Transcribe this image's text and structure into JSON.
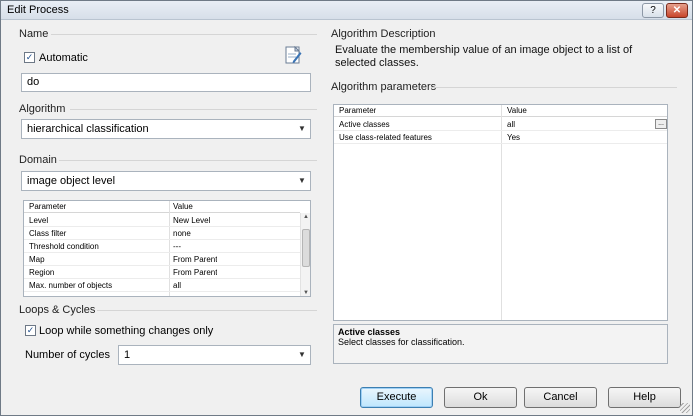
{
  "window": {
    "title": "Edit Process",
    "help_glyph": "?",
    "close_glyph": "✕"
  },
  "name_section": {
    "label": "Name",
    "automatic_label": "Automatic",
    "automatic_checked": true,
    "name_value": "do",
    "edit_icon": "notepad-edit-icon"
  },
  "algorithm_section": {
    "label": "Algorithm",
    "selected": "hierarchical classification"
  },
  "domain_section": {
    "label": "Domain",
    "selected": "image object level",
    "grid_headers": [
      "Parameter",
      "Value"
    ],
    "rows": [
      [
        "Level",
        "New Level"
      ],
      [
        "Class filter",
        "none"
      ],
      [
        "Threshold condition",
        "---"
      ],
      [
        "Map",
        "From Parent"
      ],
      [
        "Region",
        "From Parent"
      ],
      [
        "Max. number of objects",
        "all"
      ]
    ]
  },
  "loops_section": {
    "label": "Loops & Cycles",
    "loop_label": "Loop while something changes only",
    "loop_checked": true,
    "cycles_label": "Number of cycles",
    "cycles_value": "1"
  },
  "description_section": {
    "label": "Algorithm Description",
    "text": "Evaluate the membership value of an image object to a list of selected classes."
  },
  "parameters_section": {
    "label": "Algorithm parameters",
    "grid_headers": [
      "Parameter",
      "Value"
    ],
    "rows": [
      [
        "Active classes",
        "all"
      ],
      [
        "Use class-related features",
        "Yes"
      ]
    ],
    "ellipsis_label": "...",
    "info_title": "Active classes",
    "info_text": "Select classes for classification."
  },
  "buttons": {
    "execute": "Execute",
    "ok": "Ok",
    "cancel": "Cancel",
    "help": "Help"
  },
  "glyphs": {
    "check": "✓",
    "dropdown": "▼",
    "scroll_up": "▲",
    "scroll_down": "▼"
  }
}
